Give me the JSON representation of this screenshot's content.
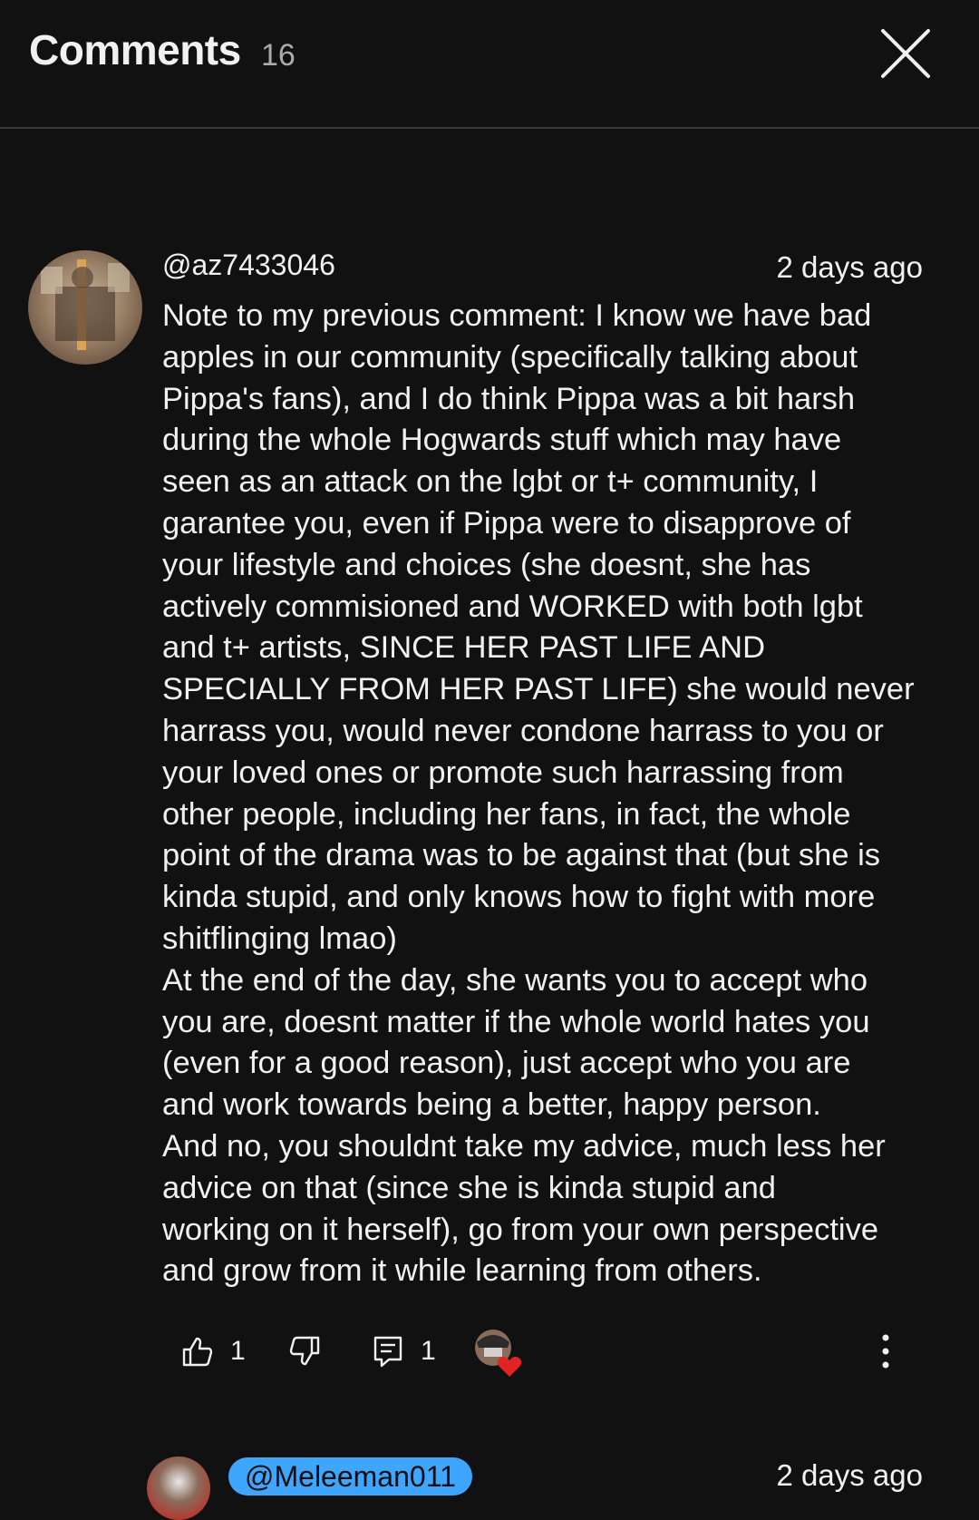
{
  "header": {
    "title": "Comments",
    "count": "16"
  },
  "comment": {
    "author": "@az7433046",
    "time": "2 days ago",
    "lines": [
      "Note to my previous comment: I know we have bad",
      "apples in our community (specifically talking about",
      "Pippa's fans), and I do think Pippa was a bit harsh",
      "during the whole Hogwards stuff which may have",
      "seen as an attack on the lgbt or t+ community, I",
      "garantee you, even if Pippa were to disapprove of",
      "your lifestyle and choices (she doesnt, she has",
      "actively commisioned and WORKED with both lgbt",
      "and t+ artists, SINCE HER PAST LIFE AND",
      "SPECIALLY FROM HER PAST LIFE) she would never",
      "harrass you, would never condone harrass to you or",
      "your loved ones or  promote such harrassing from",
      "other people, including her fans, in fact, the whole",
      "point of the drama was to be against that (but she is",
      "kinda stupid, and only knows how to fight with more",
      "shitflinging lmao)",
      "At the end of the day, she wants you to accept who",
      "you are, doesnt matter if the whole world hates you",
      "(even for a good reason), just accept who you are",
      "and work towards being a better, happy person.",
      "And no, you shouldnt take my advice, much less her",
      "advice on that (since she is kinda stupid and",
      "working on it herself), go from your own perspective",
      "and grow from it while learning from others."
    ],
    "likes": "1",
    "replies": "1"
  },
  "next_comment": {
    "author": "@Meleeman011",
    "time": "2 days ago"
  },
  "icons": {
    "close": "close-icon",
    "like": "thumb-up-icon",
    "dislike": "thumb-down-icon",
    "reply": "reply-icon",
    "heart": "creator-heart-icon",
    "more": "more-vertical-icon"
  },
  "colors": {
    "background": "#111112",
    "text": "#f1f1f1",
    "secondary_text": "#aaaaaa",
    "chip": "#3ea6ff",
    "heart": "#e02424"
  }
}
